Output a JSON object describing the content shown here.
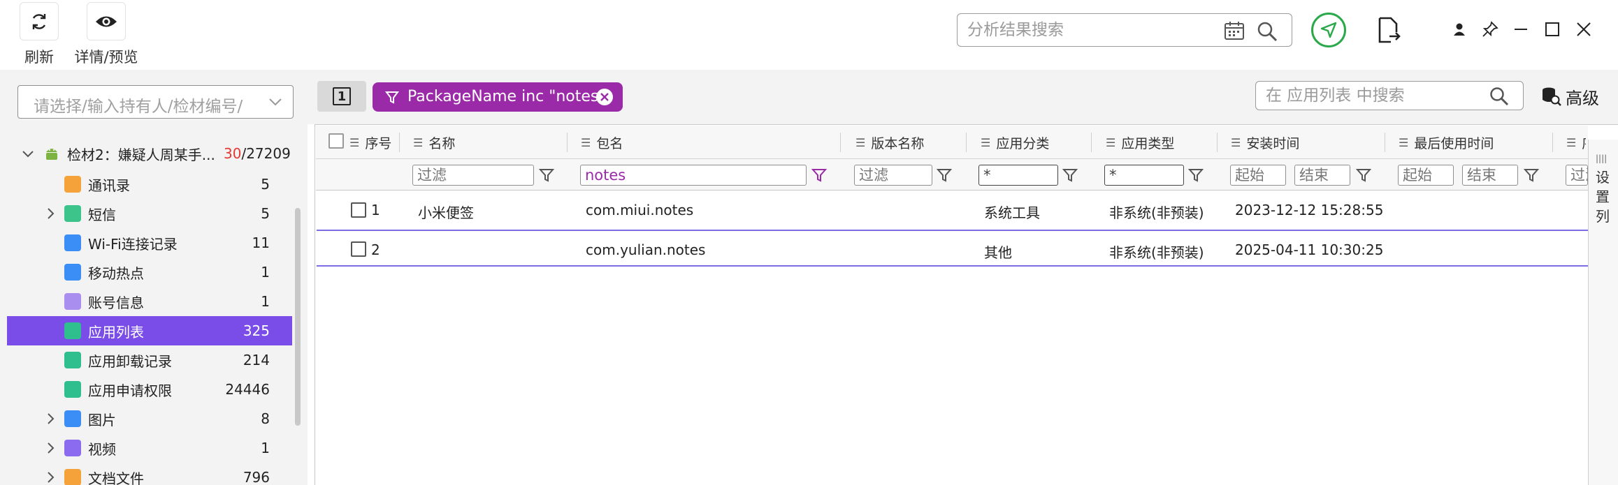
{
  "toolbar": {
    "refresh_label": "刷新",
    "details_label": "详情/预览",
    "search_placeholder": "分析结果搜索"
  },
  "sidebar": {
    "evidence_placeholder": "请选择/输入持有人/检材编号/",
    "root": {
      "label": "检材2：嫌疑人周某手...",
      "count_highlight": "30",
      "count_total": "/27209"
    },
    "items": [
      {
        "label": "通讯录",
        "count": "5",
        "icon": "contacts-icon",
        "color": "#f5a23a",
        "expandable": false
      },
      {
        "label": "短信",
        "count": "5",
        "icon": "sms-icon",
        "color": "#3cc48a",
        "expandable": true
      },
      {
        "label": "Wi-Fi连接记录",
        "count": "11",
        "icon": "wifi-icon",
        "color": "#3a8ef5",
        "expandable": false
      },
      {
        "label": "移动热点",
        "count": "1",
        "icon": "hotspot-icon",
        "color": "#3a8ef5",
        "expandable": false
      },
      {
        "label": "账号信息",
        "count": "1",
        "icon": "account-icon",
        "color": "#a98ef0",
        "expandable": false
      },
      {
        "label": "应用列表",
        "count": "325",
        "icon": "app-list-icon",
        "color": "#2fbf8f",
        "expandable": false,
        "active": true
      },
      {
        "label": "应用卸载记录",
        "count": "214",
        "icon": "app-uninstall-icon",
        "color": "#2fbf8f",
        "expandable": false
      },
      {
        "label": "应用申请权限",
        "count": "24446",
        "icon": "app-permission-icon",
        "color": "#2fbf8f",
        "expandable": false
      },
      {
        "label": "图片",
        "count": "8",
        "icon": "image-icon",
        "color": "#3a8ef5",
        "expandable": true
      },
      {
        "label": "视频",
        "count": "1",
        "icon": "video-icon",
        "color": "#8b6cf0",
        "expandable": true
      },
      {
        "label": "文档文件",
        "count": "796",
        "icon": "document-icon",
        "color": "#f5a23a",
        "expandable": true
      }
    ]
  },
  "main": {
    "page_button": "1",
    "filter_chip": "PackageName inc \"notes\"",
    "table_search_placeholder": "在 应用列表 中搜索",
    "advanced_label": "高级",
    "columns": [
      "序号",
      "名称",
      "包名",
      "版本名称",
      "应用分类",
      "应用类型",
      "安装时间",
      "最后使用时间",
      "序"
    ],
    "filters": {
      "name": "过滤",
      "package": "notes",
      "version": "过滤",
      "category": "*",
      "type": "*",
      "install_start": "起始",
      "install_end": "结束",
      "last_start": "起始",
      "last_end": "结束",
      "extra": "过滤"
    },
    "rows": [
      {
        "index": "1",
        "name": "小米便签",
        "package": "com.miui.notes",
        "version": "",
        "category": "系统工具",
        "type": "非系统(非预装)",
        "install_time": "2023-12-12 15:28:55",
        "last_used": ""
      },
      {
        "index": "2",
        "name": "",
        "package": "com.yulian.notes",
        "version": "",
        "category": "其他",
        "type": "非系统(非预装)",
        "install_time": "2025-04-11 10:30:25",
        "last_used": ""
      }
    ],
    "settings_column": "设置列"
  },
  "colors": {
    "accent": "#7a4de8",
    "chip": "#9a2aa8",
    "row_separator": "#7b6de6",
    "location_button": "#2aa84a"
  }
}
